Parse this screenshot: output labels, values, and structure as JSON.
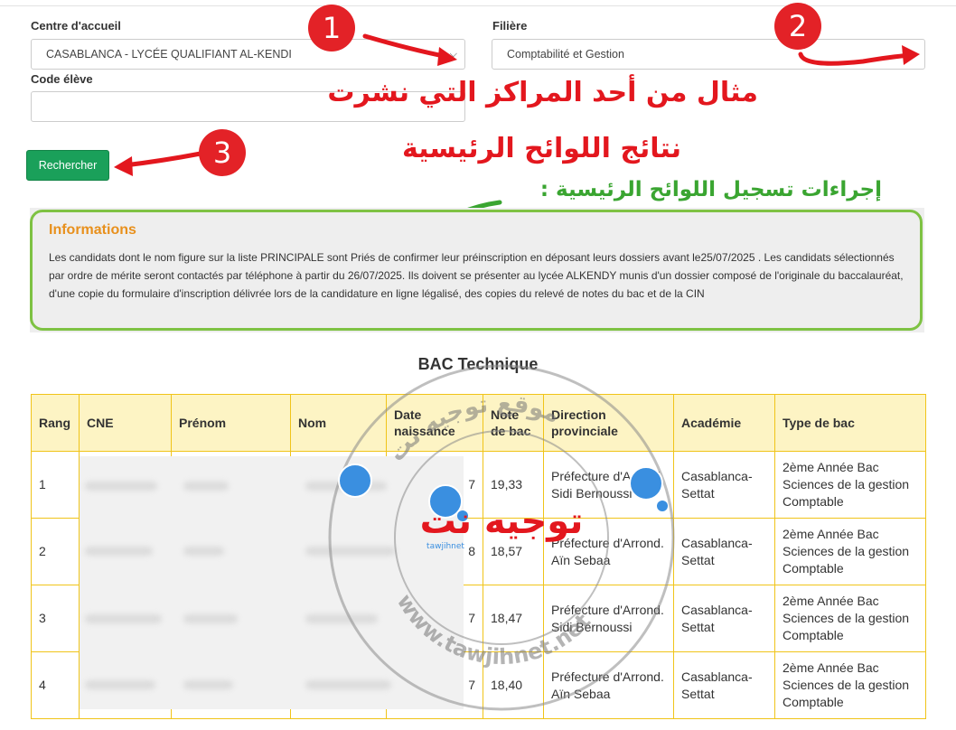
{
  "form": {
    "centre_label": "Centre d'accueil",
    "centre_value": "CASABLANCA - LYCÉE QUALIFIANT AL-KENDI",
    "filiere_label": "Filière",
    "filiere_value": "Comptabilité et Gestion",
    "code_label": "Code élève",
    "code_value": "",
    "search_button": "Rechercher"
  },
  "annotations": {
    "step1": "1",
    "step2": "2",
    "step3": "3",
    "arabic_line1": "مثال من أحد المراكز التي نشرت",
    "arabic_line2": "نتائج اللوائح الرئيسية",
    "arabic_line3": "إجراءات تسجيل اللوائح الرئيسية :",
    "colors": {
      "red": "#e3171e",
      "green": "#3aa531"
    }
  },
  "info": {
    "title": "Informations",
    "text": "Les candidats dont le nom figure sur la liste PRINCIPALE sont Priés de confirmer leur préinscription en déposant leurs dossiers avant le25/07/2025 . Les candidats sélectionnés par ordre de mérite seront contactés par téléphone à partir du 26/07/2025. Ils doivent se présenter au lycée ALKENDY munis d'un dossier composé de l'originale du baccalauréat, d'une copie du formulaire d'inscription délivrée lors de la candidature en ligne légalisé, des copies du relevé de notes du bac et de la CIN"
  },
  "results": {
    "title": "BAC Technique",
    "columns": [
      "Rang",
      "CNE",
      "Prénom",
      "Nom",
      "Date naissance",
      "Note de bac",
      "Direction provinciale",
      "Académie",
      "Type de bac"
    ],
    "rows": [
      {
        "rang": "1",
        "cne": "",
        "prenom": "",
        "nom": "",
        "date": "7",
        "note": "19,33",
        "direction": "Préfecture d'Arrond. Sidi Bernoussi",
        "academie": "Casablanca-Settat",
        "type": "2ème Année Bac Sciences de la gestion Comptable"
      },
      {
        "rang": "2",
        "cne": "",
        "prenom": "",
        "nom": "",
        "date": "8",
        "note": "18,57",
        "direction": "Préfecture d'Arrond. Aïn Sebaa",
        "academie": "Casablanca-Settat",
        "type": "2ème Année Bac Sciences de la gestion Comptable"
      },
      {
        "rang": "3",
        "cne": "",
        "prenom": "",
        "nom": "",
        "date": "7",
        "note": "18,47",
        "direction": "Préfecture d'Arrond. Sidi Bernoussi",
        "academie": "Casablanca-Settat",
        "type": "2ème Année Bac Sciences de la gestion Comptable"
      },
      {
        "rang": "4",
        "cne": "",
        "prenom": "",
        "nom": "",
        "date": "7",
        "note": "18,40",
        "direction": "Préfecture d'Arrond. Aïn Sebaa",
        "academie": "Casablanca-Settat",
        "type": "2ème Année Bac Sciences de la gestion Comptable"
      }
    ]
  },
  "watermark": {
    "arabic_name": "توجيه نت",
    "arc_text": "موقع توجيه نت",
    "url_text": "www.tawjihnet.net",
    "logo_text": "tawjihnet"
  }
}
